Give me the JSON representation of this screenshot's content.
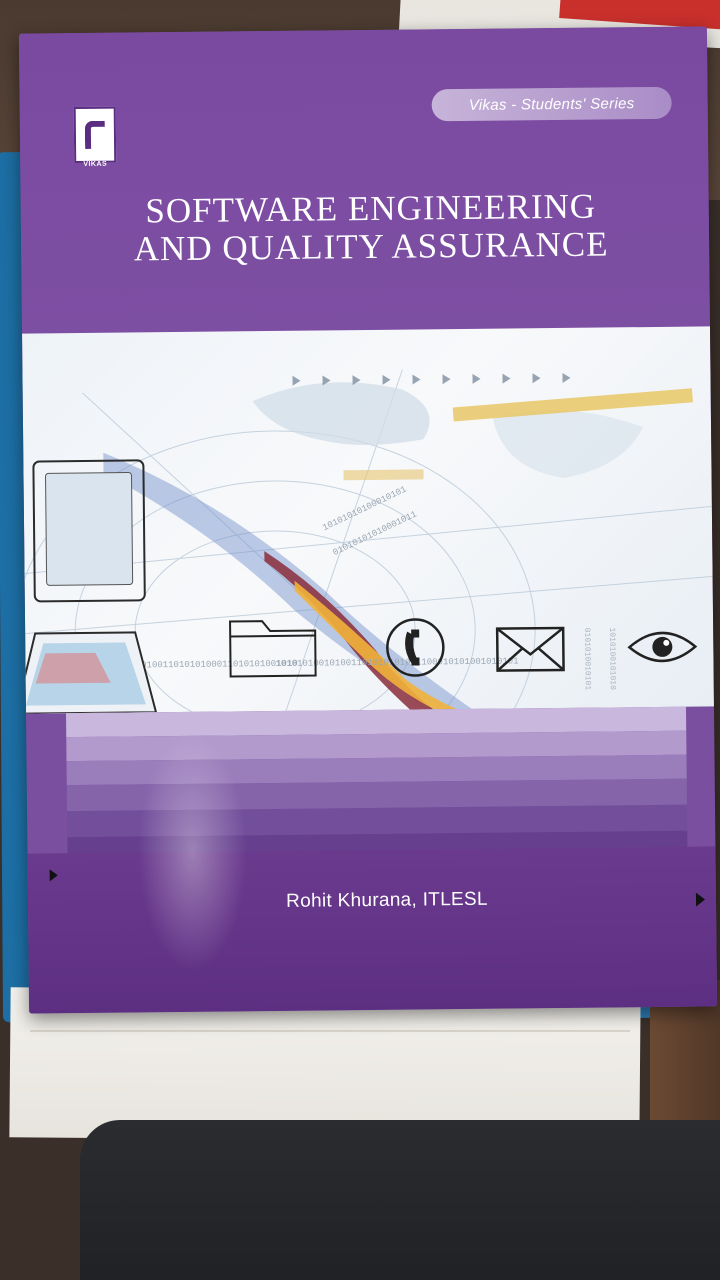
{
  "book": {
    "publisher_logo_text": "VIKAS",
    "series": "Vikas - Students' Series",
    "title_line1": "SOFTWARE ENGINEERING",
    "title_line2": "AND QUALITY ASSURANCE",
    "author": "Rohit Khurana, ITLESL"
  },
  "icons": [
    "folder-icon",
    "phone-icon",
    "envelope-icon",
    "eye-icon"
  ],
  "colors": {
    "cover_purple": "#7b4fa0",
    "cover_dark_purple": "#5d2f82",
    "blue_book": "#2a7bb2"
  }
}
